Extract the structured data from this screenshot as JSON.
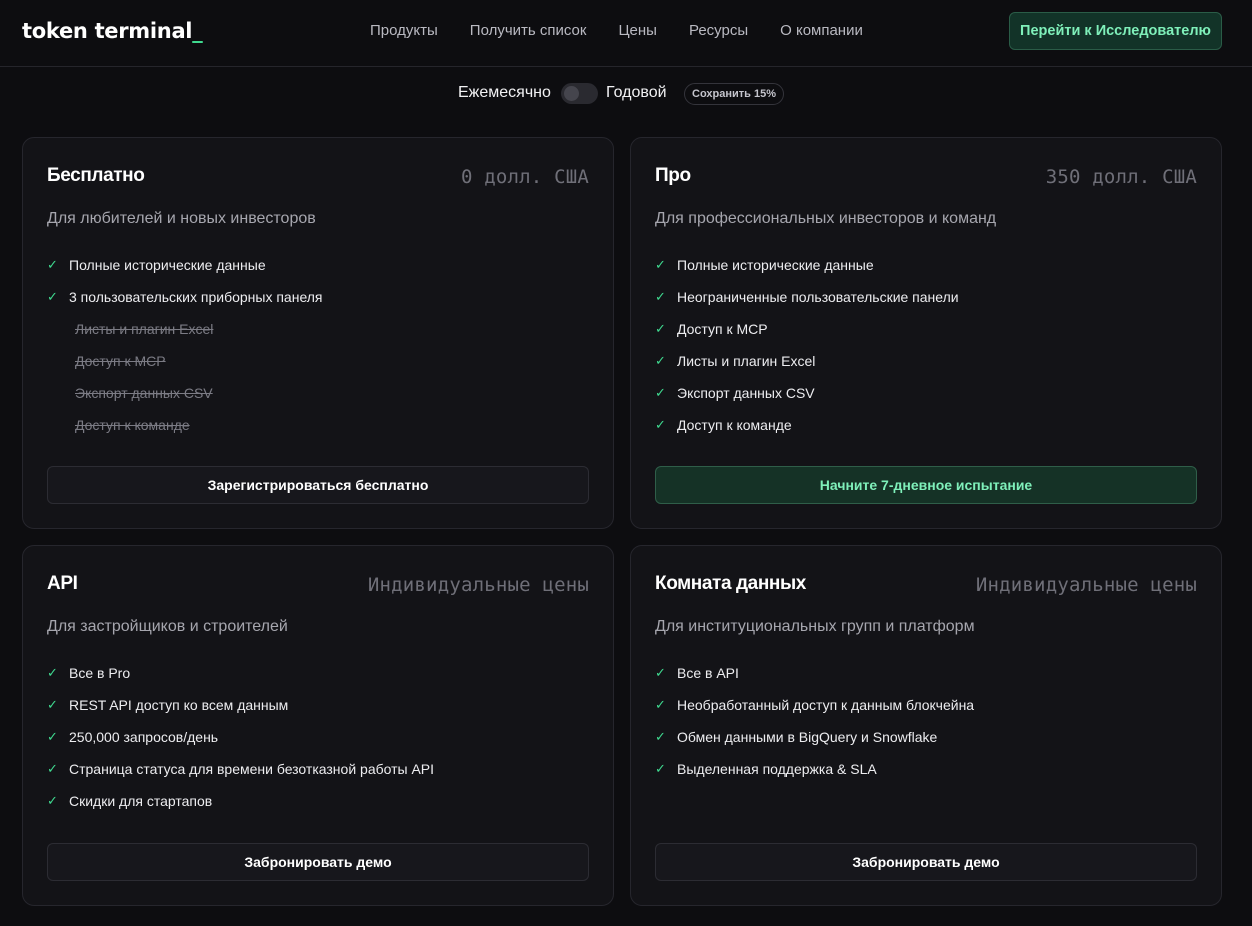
{
  "header": {
    "logo_text": "token terminal",
    "logo_cursor": "_",
    "nav": [
      "Продукты",
      "Получить список",
      "Цены",
      "Ресурсы",
      "О компании"
    ],
    "cta_label": "Перейти к Исследователю"
  },
  "billing": {
    "monthly_label": "Ежемесячно",
    "yearly_label": "Годовой",
    "save_badge": "Сохранить 15%",
    "annual_selected": false
  },
  "plans": [
    {
      "title": "Бесплатно",
      "price": "0 долл. США",
      "subtitle": "Для любителей и новых инвесторов",
      "features": [
        {
          "text": "Полные исторические данные",
          "included": true
        },
        {
          "text": "3 пользовательских приборных панеля",
          "included": true
        },
        {
          "text": "Листы и плагин Excel",
          "included": false
        },
        {
          "text": "Доступ к MCP",
          "included": false
        },
        {
          "text": "Экспорт данных CSV",
          "included": false
        },
        {
          "text": "Доступ к команде",
          "included": false
        }
      ],
      "button": "Зарегистрироваться бесплатно",
      "button_style": "secondary"
    },
    {
      "title": "Про",
      "price": "350 долл. США",
      "subtitle": "Для профессиональных инвесторов и команд",
      "features": [
        {
          "text": "Полные исторические данные",
          "included": true
        },
        {
          "text": "Неограниченные пользовательские панели",
          "included": true
        },
        {
          "text": "Доступ к MCP",
          "included": true
        },
        {
          "text": "Листы и плагин Excel",
          "included": true
        },
        {
          "text": "Экспорт данных CSV",
          "included": true
        },
        {
          "text": "Доступ к команде",
          "included": true
        }
      ],
      "button": "Начните 7-дневное испытание",
      "button_style": "primary"
    },
    {
      "title": "API",
      "price": "Индивидуальные цены",
      "subtitle": "Для застройщиков и строителей",
      "features": [
        {
          "text": "Все в Pro",
          "included": true
        },
        {
          "text": "REST API доступ ко всем данным",
          "included": true
        },
        {
          "text": "250,000 запросов/день",
          "included": true
        },
        {
          "text": "Страница статуса для времени безотказной работы API",
          "included": true
        },
        {
          "text": "Скидки для стартапов",
          "included": true
        }
      ],
      "button": "Забронировать демо",
      "button_style": "secondary"
    },
    {
      "title": "Комната данных",
      "price": "Индивидуальные цены",
      "subtitle": "Для институциональных групп и платформ",
      "features": [
        {
          "text": "Все в API",
          "included": true
        },
        {
          "text": "Необработанный доступ к данным блокчейна",
          "included": true
        },
        {
          "text": "Обмен данными в BigQuery и Snowflake",
          "included": true
        },
        {
          "text": "Выделенная поддержка & SLA",
          "included": true
        }
      ],
      "button": "Забронировать демо",
      "button_style": "secondary"
    }
  ],
  "icons": {
    "check": "check-icon",
    "toggle": "toggle-switch"
  },
  "colors": {
    "background": "#0d0d10",
    "card": "#131317",
    "accent": "#3fd98f",
    "accent_text": "#7ff0ba",
    "accent_bg": "#153226"
  }
}
